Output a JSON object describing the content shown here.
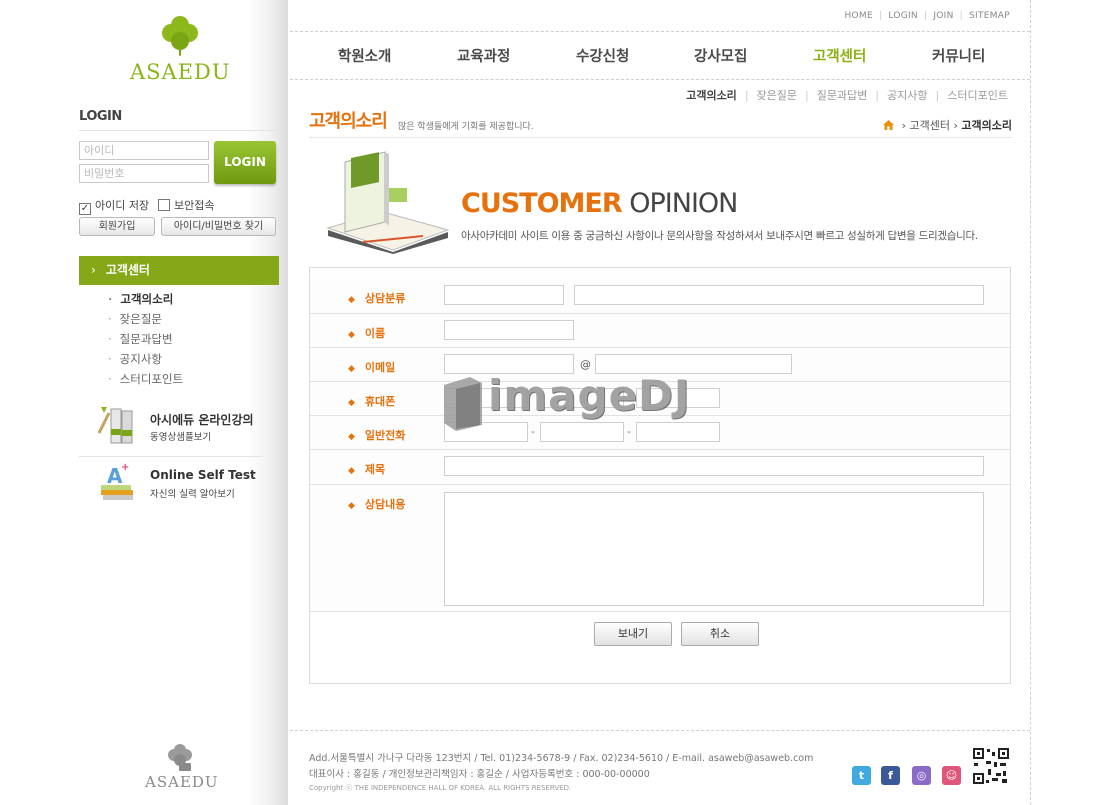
{
  "brand": {
    "logo_text": "ASAEDU"
  },
  "login": {
    "title": "LOGIN",
    "id_placeholder": "아이디",
    "pw_placeholder": "비밀번호",
    "button": "LOGIN",
    "save_id": "아이디 저장",
    "secure": "보안접속",
    "join": "회원가입",
    "find": "아이디/비밀번호 찾기"
  },
  "sidebar": {
    "menu_title": "고객센터",
    "items": [
      {
        "label": "고객의소리"
      },
      {
        "label": "잦은질문"
      },
      {
        "label": "질문과답변"
      },
      {
        "label": "공지사항"
      },
      {
        "label": "스터디포인트"
      }
    ],
    "promo1": {
      "title": "아시에듀 온라인강의",
      "sub": "동영상샘플보기"
    },
    "promo2": {
      "title": "Online Self Test",
      "sub": "자신의 실력 알아보기"
    }
  },
  "util": [
    "HOME",
    "LOGIN",
    "JOIN",
    "SITEMAP"
  ],
  "gnb": [
    "학원소개",
    "교육과정",
    "수강신청",
    "강사모집",
    "고객센터",
    "커뮤니티"
  ],
  "lnb": [
    "고객의소리",
    "잦은질문",
    "질문과답변",
    "공지사항",
    "스터디포인트"
  ],
  "page": {
    "title": "고객의소리",
    "desc": "많은 학생들에게 기회를 제공합니다.",
    "breadcrumb": [
      "고객센터",
      "고객의소리"
    ],
    "heading_bold": "CUSTOMER",
    "heading_rest": "OPINION",
    "heading_desc": "아사아카데미 사이트 이용 중 궁금하신 사항이나 문의사항을 작성하셔서 보내주시면 빠르고 성실하게 답변을 드리겠습니다."
  },
  "form": {
    "category": "상담분류",
    "name": "이름",
    "email": "이메일",
    "email_at": "@",
    "mobile": "휴대폰",
    "phone": "일반전화",
    "phone_sep": "-",
    "subject": "제목",
    "content": "상담내용",
    "submit": "보내기",
    "cancel": "취소"
  },
  "watermark": "imageDJ",
  "footer": {
    "address": "Add.서울특별시 가나구 다라동 123번지  / Tel. 01)234-5678-9  / Fax. 02)234-5610  / E-mail. asaweb@asaweb.com",
    "info": "대표이사 : 홍길동 / 개인정보관리책임자 : 홍길순 / 사업자등록번호 : 000-00-00000",
    "copyright": "Copyright ⓒ THE INDEPENDENCE HALL OF KOREA. ALL RIGHTS RESERVED.",
    "sns": [
      "twitter-icon",
      "facebook-icon",
      "blog-icon",
      "cyworld-icon"
    ]
  },
  "colors": {
    "accent_green": "#86a818",
    "accent_orange": "#e6720e"
  }
}
